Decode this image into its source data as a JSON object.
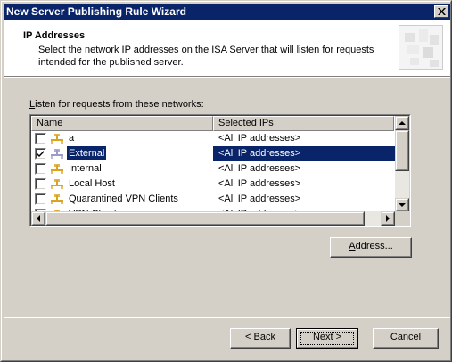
{
  "window": {
    "title": "New Server Publishing Rule Wizard"
  },
  "header": {
    "title": "IP Addresses",
    "description": "Select the network IP addresses on the ISA Server that will listen for requests intended for the published server."
  },
  "networks": {
    "label": "Listen for requests from these networks:",
    "columns": [
      "Name",
      "Selected IPs"
    ],
    "rows": [
      {
        "name": "a",
        "ips": "<All IP addresses>",
        "checked": false,
        "selected": false
      },
      {
        "name": "External",
        "ips": "<All IP addresses>",
        "checked": true,
        "selected": true
      },
      {
        "name": "Internal",
        "ips": "<All IP addresses>",
        "checked": false,
        "selected": false
      },
      {
        "name": "Local Host",
        "ips": "<All IP addresses>",
        "checked": false,
        "selected": false
      },
      {
        "name": "Quarantined VPN Clients",
        "ips": "<All IP addresses>",
        "checked": false,
        "selected": false
      },
      {
        "name": "VPN Clients",
        "ips": "<All IP addresses>",
        "checked": false,
        "selected": false
      }
    ]
  },
  "buttons": {
    "address_pre": "",
    "address_ul": "A",
    "address_post": "ddress...",
    "back_pre": "< ",
    "back_ul": "B",
    "back_post": "ack",
    "next_pre": "",
    "next_ul": "N",
    "next_post": "ext >",
    "cancel": "Cancel"
  },
  "colors": {
    "selection": "#0a246a",
    "face": "#d4d0c8",
    "network_icon": "#d9a520"
  }
}
